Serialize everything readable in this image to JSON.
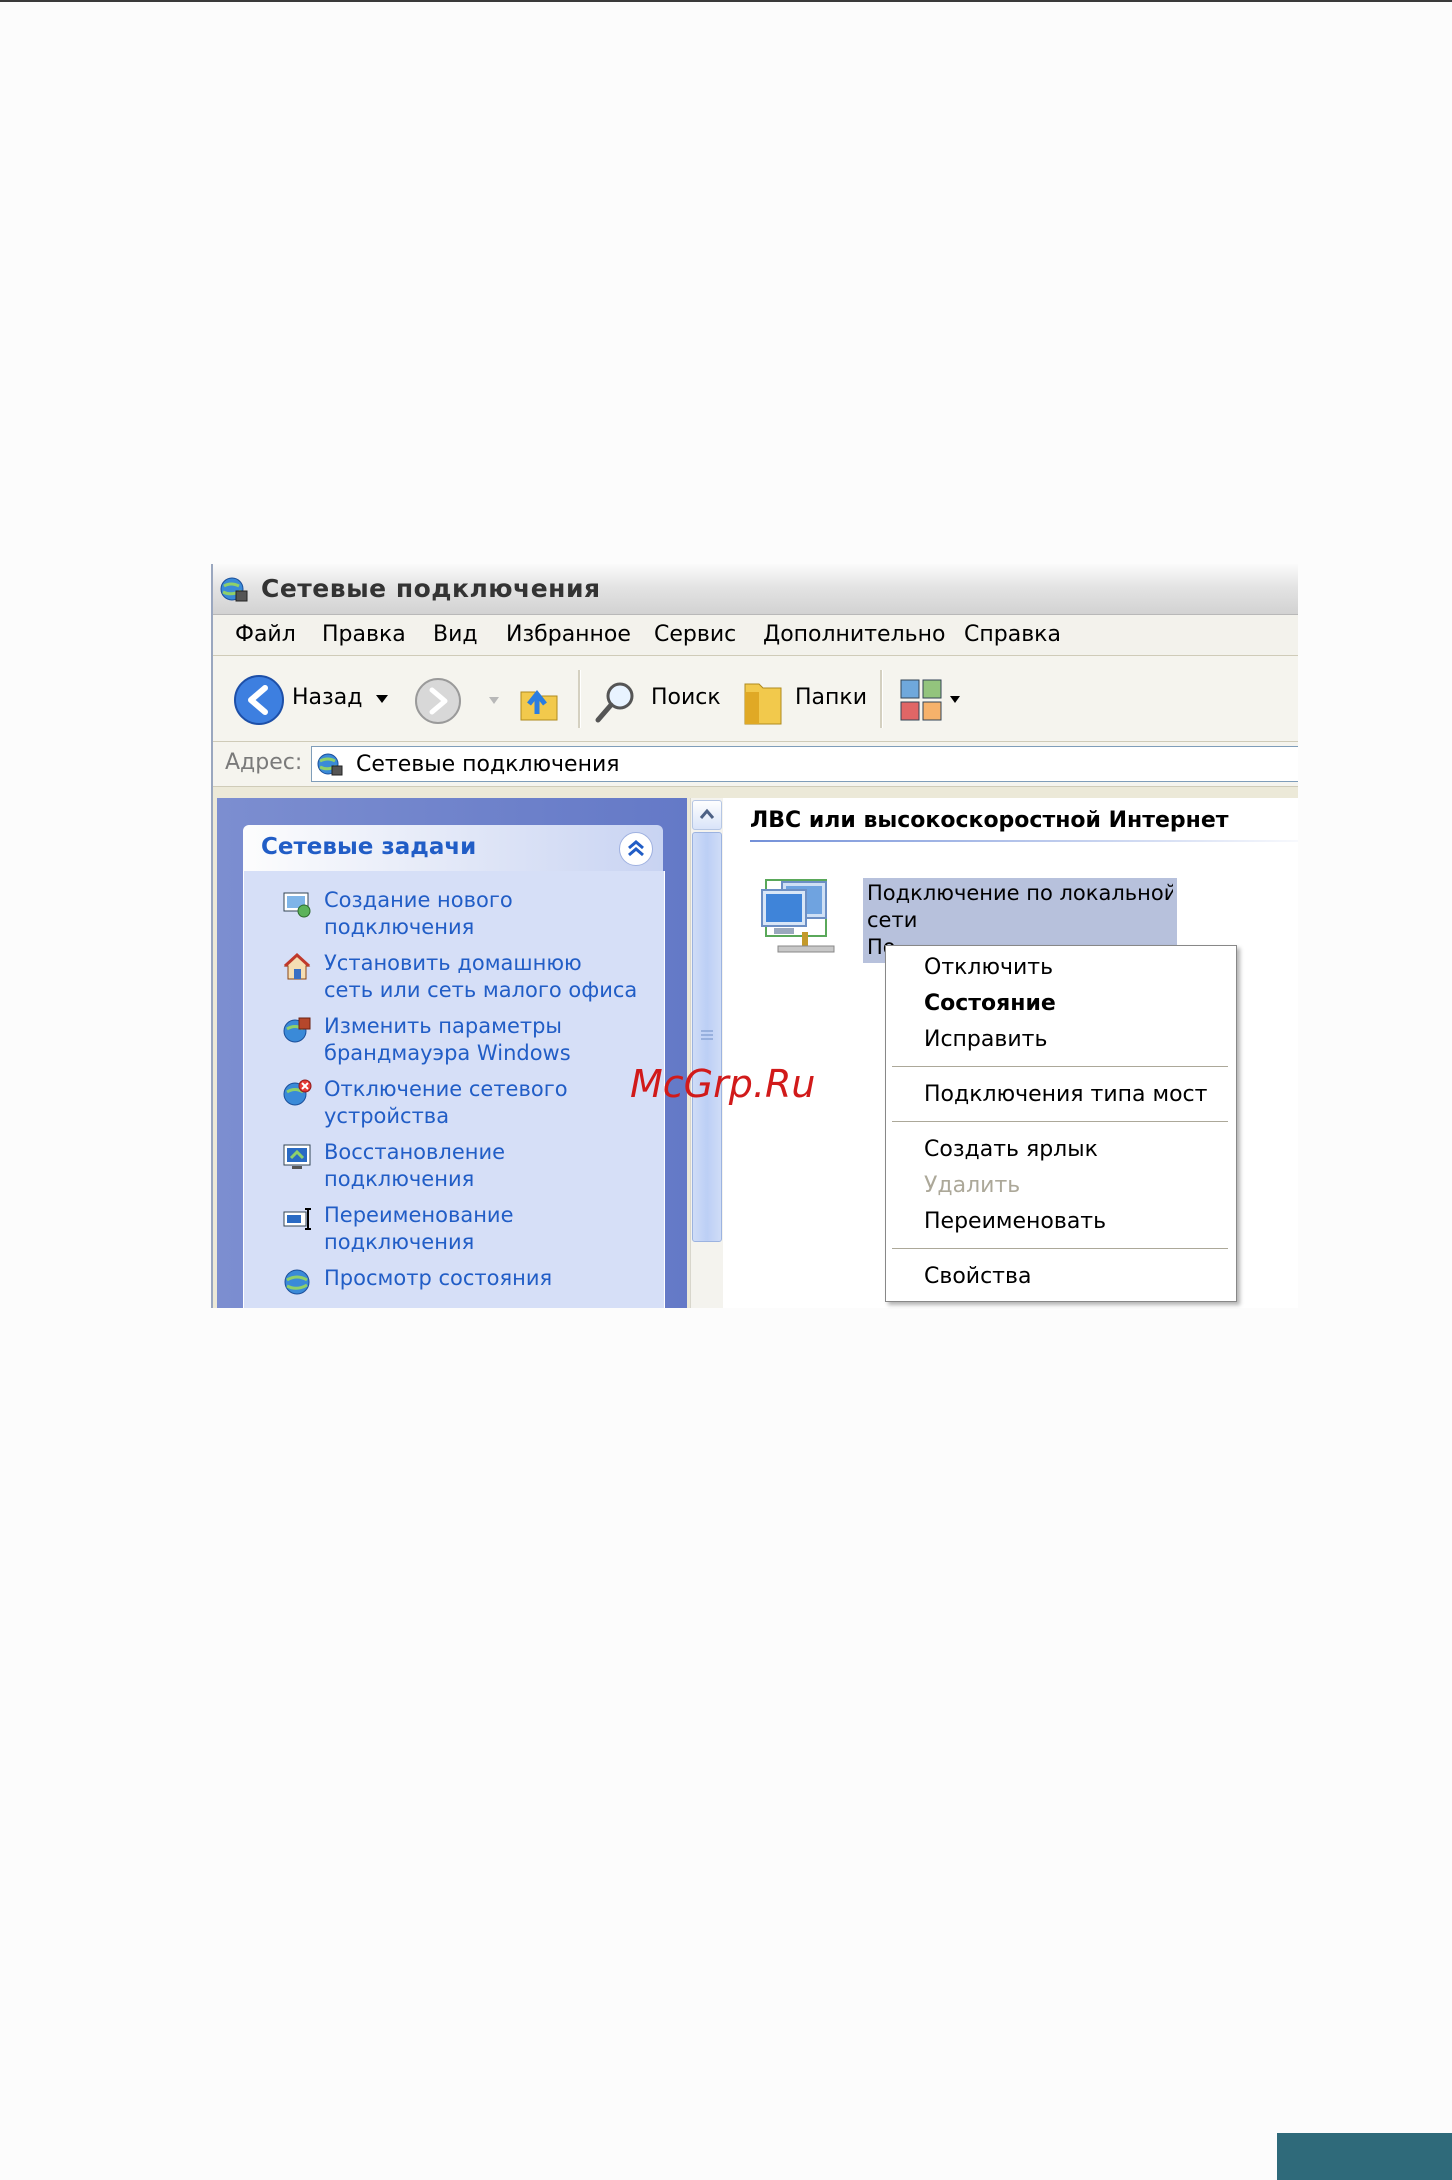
{
  "window": {
    "title": "Сетевые подключения"
  },
  "menu": [
    "Файл",
    "Правка",
    "Вид",
    "Избранное",
    "Сервис",
    "Дополнительно",
    "Справка"
  ],
  "toolbar": {
    "back_label": "Назад",
    "search_label": "Поиск",
    "folders_label": "Папки"
  },
  "address": {
    "label": "Адрес:",
    "value": "Сетевые подключения"
  },
  "tasks": {
    "header": "Сетевые задачи",
    "items": [
      {
        "line1": "Создание нового",
        "line2": "подключения",
        "icon": "new-connection-icon"
      },
      {
        "line1": "Установить домашнюю",
        "line2": "сеть или сеть малого офиса",
        "icon": "home-network-icon"
      },
      {
        "line1": "Изменить параметры",
        "line2": "брандмауэра Windows",
        "icon": "firewall-icon"
      },
      {
        "line1": "Отключение сетевого",
        "line2": "устройства",
        "icon": "disable-device-icon"
      },
      {
        "line1": "Восстановление",
        "line2": "подключения",
        "icon": "repair-icon"
      },
      {
        "line1": "Переименование",
        "line2": "подключения",
        "icon": "rename-icon"
      },
      {
        "line1": "Просмотр состояния",
        "line2": "",
        "icon": "status-icon"
      }
    ]
  },
  "content": {
    "group_header": "ЛВС или высокоскоростной Интернет",
    "connection": {
      "line1": "Подключение по локальной",
      "line2": "сети",
      "line3": "По"
    }
  },
  "context_menu": {
    "disable": "Отключить",
    "status": "Состояние",
    "repair": "Исправить",
    "bridge": "Подключения типа мост",
    "shortcut": "Создать ярлык",
    "delete": "Удалить",
    "rename": "Переименовать",
    "properties": "Свойства"
  },
  "watermark": "McGrp.Ru",
  "colors": {
    "task_text": "#215dc6",
    "selection": "#b7c1dc",
    "watermark": "#d11a1a",
    "corner_block": "#2f6a7a"
  }
}
